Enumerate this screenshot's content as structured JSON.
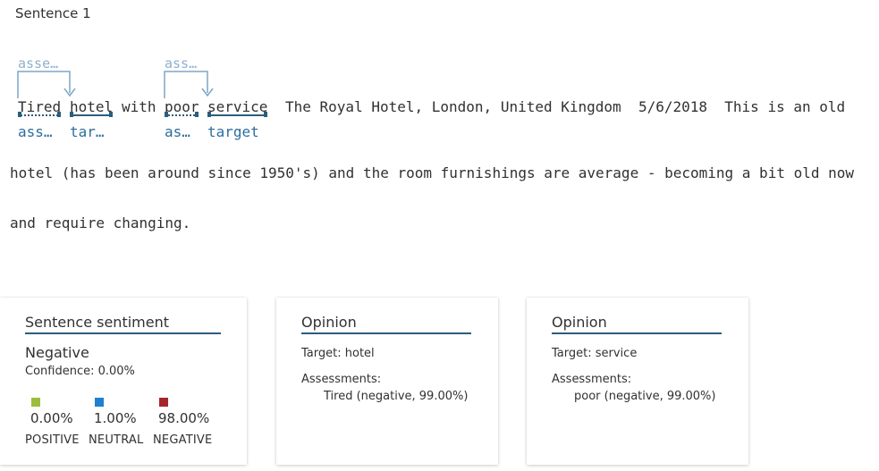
{
  "sentence": {
    "header": "Sentence 1",
    "tokens": [
      {
        "text": "Tired",
        "role": "ass…"
      },
      {
        "text": "hotel",
        "role": "tar…"
      },
      {
        "text": "with"
      },
      {
        "text": "poor",
        "role": "as…"
      },
      {
        "text": "service",
        "role": "target"
      }
    ],
    "line1_rest": "The Royal Hotel, London, United Kingdom  5/6/2018  This is an old",
    "line2": "hotel (has been around since 1950's) and the room furnishings are average - becoming a bit old now",
    "line3": "and require changing.",
    "arcs": [
      {
        "label": "asse…"
      },
      {
        "label": "ass…"
      }
    ]
  },
  "sentiment_card": {
    "title": "Sentence sentiment",
    "label": "Negative",
    "confidence": "Confidence: 0.00%",
    "scores": [
      {
        "name": "POSITIVE",
        "value": "0.00%",
        "color": "#9dbd3e"
      },
      {
        "name": "NEUTRAL",
        "value": "1.00%",
        "color": "#1f80d0"
      },
      {
        "name": "NEGATIVE",
        "value": "98.00%",
        "color": "#a4262c"
      }
    ]
  },
  "opinions": [
    {
      "title": "Opinion",
      "target_key": "Target:",
      "target_value": "hotel",
      "assessments_key": "Assessments:",
      "assessment": "Tired (negative, 99.00%)"
    },
    {
      "title": "Opinion",
      "target_key": "Target:",
      "target_value": "service",
      "assessments_key": "Assessments:",
      "assessment": "poor (negative, 99.00%)"
    }
  ]
}
